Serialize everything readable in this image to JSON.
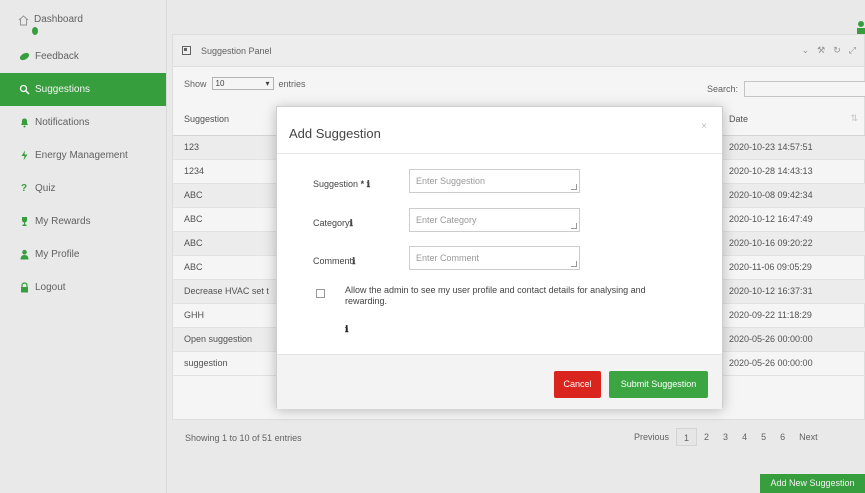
{
  "sidebar": {
    "items": [
      {
        "label": "Dashboard",
        "icon": "home-icon"
      },
      {
        "label": "Feedback",
        "icon": "leaf-icon"
      },
      {
        "label": "Suggestions",
        "icon": "magnifier-icon"
      },
      {
        "label": "Notifications",
        "icon": "bell-icon"
      },
      {
        "label": "Energy Management",
        "icon": "bolt-icon"
      },
      {
        "label": "Quiz",
        "icon": "question-icon"
      },
      {
        "label": "My Rewards",
        "icon": "trophy-icon"
      },
      {
        "label": "My Profile",
        "icon": "user-icon"
      },
      {
        "label": "Logout",
        "icon": "lock-icon"
      }
    ]
  },
  "panel": {
    "title": "Suggestion Panel",
    "show_label": "Show",
    "entries_value": "10",
    "entries_label": "entries",
    "search_label": "Search:",
    "columns": [
      "Suggestion",
      "Date"
    ],
    "rows": [
      {
        "suggestion": "123",
        "date": "2020-10-23 14:57:51"
      },
      {
        "suggestion": "1234",
        "date": "2020-10-28 14:43:13"
      },
      {
        "suggestion": "ABC",
        "date": "2020-10-08 09:42:34"
      },
      {
        "suggestion": "ABC",
        "date": "2020-10-12 16:47:49"
      },
      {
        "suggestion": "ABC",
        "date": "2020-10-16 09:20:22"
      },
      {
        "suggestion": "ABC",
        "date": "2020-11-06 09:05:29"
      },
      {
        "suggestion": "Decrease HVAC set t",
        "date": "2020-10-12 16:37:31"
      },
      {
        "suggestion": "GHH",
        "date": "2020-09-22 11:18:29"
      },
      {
        "suggestion": "Open suggestion",
        "date": "2020-05-26 00:00:00"
      },
      {
        "suggestion": "suggestion",
        "date": "2020-05-26 00:00:00"
      }
    ],
    "info": "Showing 1 to 10 of 51 entries",
    "pager": {
      "previous": "Previous",
      "pages": [
        "1",
        "2",
        "3",
        "4",
        "5",
        "6"
      ],
      "next": "Next"
    },
    "add_button": "Add New Suggestion"
  },
  "modal": {
    "title": "Add Suggestion",
    "close": "×",
    "fields": [
      {
        "label": "Suggestion",
        "marker": "* ℹ",
        "placeholder": "Enter Suggestion"
      },
      {
        "label": "Category",
        "marker": "ℹ",
        "placeholder": "Enter Category"
      },
      {
        "label": "Comment",
        "marker": "ℹ",
        "placeholder": "Enter Comment"
      }
    ],
    "consent_text": "Allow the admin to see my user profile and contact details for analysing and rewarding.",
    "consent_info": "ℹ",
    "cancel": "Cancel",
    "submit": "Submit Suggestion"
  },
  "colors": {
    "accent": "#3aa541",
    "danger": "#d9251d"
  }
}
